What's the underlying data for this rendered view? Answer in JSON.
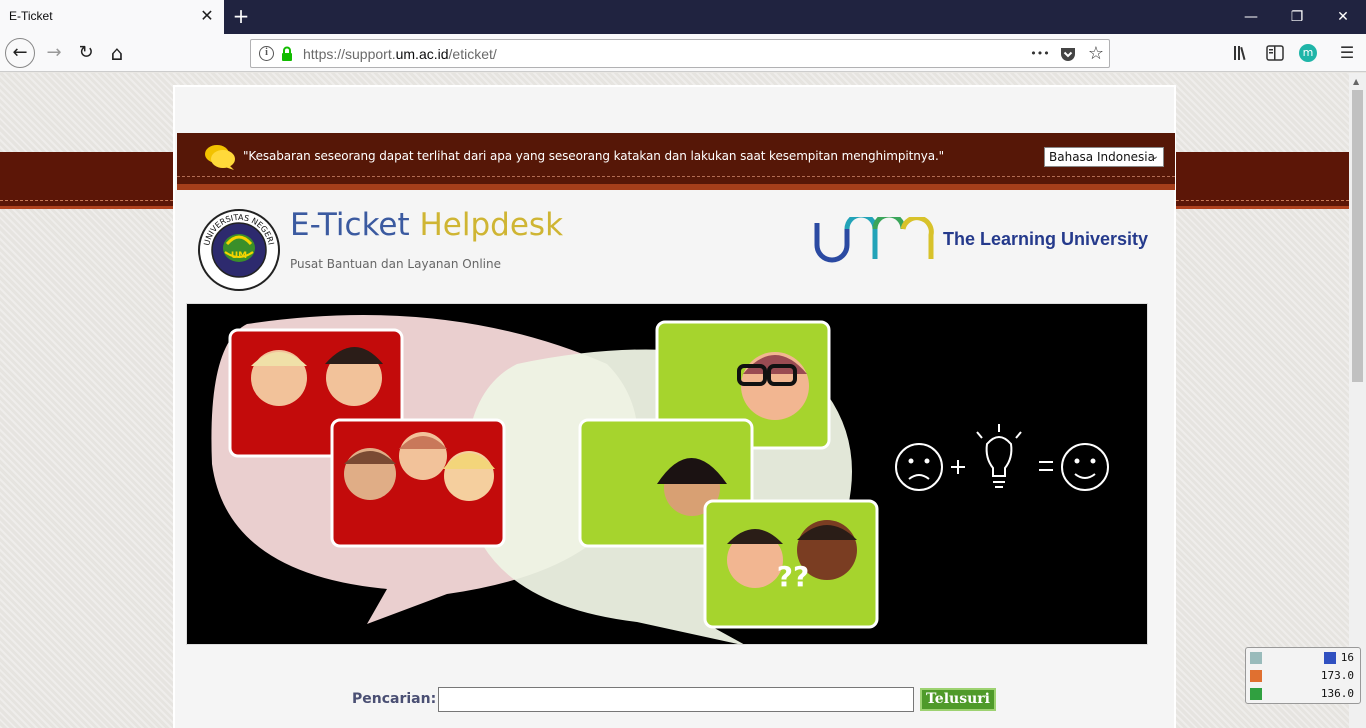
{
  "browser": {
    "tab_title": "E-Ticket",
    "tab_close_glyph": "✕",
    "new_tab_glyph": "+",
    "url_prefix": "https://support.",
    "url_domain": "um.ac.id",
    "url_path": "/eticket/",
    "window_controls": {
      "minimize": "—",
      "restore": "❐",
      "close": "✕"
    },
    "nav": {
      "back": "←",
      "forward": "→",
      "reload": "↻",
      "home": "⌂"
    },
    "url_actions": {
      "more": "•••",
      "pocket": "pocket-icon",
      "bookmark": "☆"
    },
    "toolbar": {
      "library": "library-icon",
      "sidebar": "sidebar-icon",
      "extension": "m",
      "menu": "☰"
    }
  },
  "quote_bar": {
    "quote": "\"Kesabaran seseorang dapat terlihat dari apa yang seseorang katakan dan lakukan saat kesempitan menghimpitnya.\"",
    "language": "Bahasa Indonesia"
  },
  "header": {
    "title_part1": "E-Ticket",
    "title_part2": "Helpdesk",
    "subtitle": "Pusat Bantuan dan Layanan Online",
    "seal_text": "UNIVERSITAS NEGERI MALANG",
    "seal_center": "UM",
    "tagline": "The Learning University"
  },
  "banner": {
    "question_marks": "??"
  },
  "search": {
    "label": "Pencarian:",
    "value": "",
    "button": "Telusuri"
  },
  "stats_widget": {
    "row1": "16",
    "row2": "173.0",
    "row3": "136.0"
  },
  "colors": {
    "brand_blue": "#3b5aa0",
    "brand_yellow": "#cfb533",
    "maroon": "#561707",
    "search_green": "#4f9a2a"
  }
}
